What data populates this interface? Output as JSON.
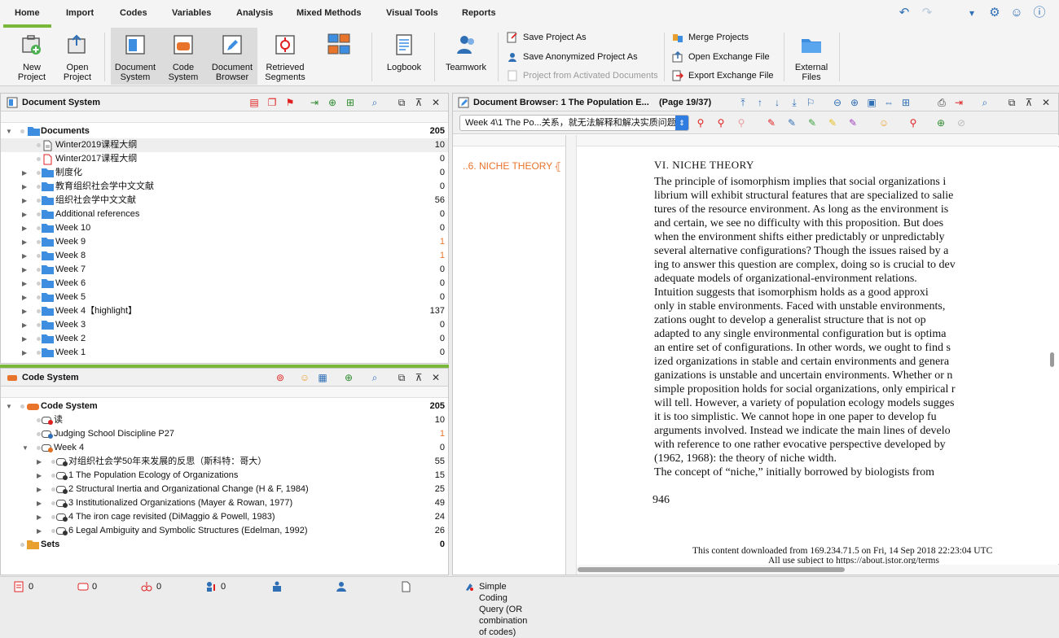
{
  "menu": {
    "tabs": [
      "Home",
      "Import",
      "Codes",
      "Variables",
      "Analysis",
      "Mixed Methods",
      "Visual Tools",
      "Reports"
    ],
    "active": "Home"
  },
  "ribbon": {
    "new_project": "New\nProject",
    "open_project": "Open\nProject",
    "document_system": "Document\nSystem",
    "code_system": "Code\nSystem",
    "document_browser": "Document\nBrowser",
    "retrieved_segments": "Retrieved\nSegments",
    "logbook": "Logbook",
    "teamwork": "Teamwork",
    "save_project_as": "Save Project As",
    "save_anonymized": "Save Anonymized Project As",
    "project_from_activated": "Project from Activated Documents",
    "merge_projects": "Merge Projects",
    "open_exchange_file": "Open Exchange File",
    "export_exchange_file": "Export Exchange File",
    "external_files": "External\nFiles"
  },
  "document_system": {
    "title": "Document System",
    "root": {
      "label": "Documents",
      "count": "205"
    },
    "items": [
      {
        "label": "Winter2019课程大纲",
        "count": "10",
        "type": "doc",
        "expand": false
      },
      {
        "label": "Winter2017课程大纲",
        "count": "0",
        "type": "pdf",
        "expand": false
      },
      {
        "label": "制度化",
        "count": "0",
        "type": "folder",
        "expand": true
      },
      {
        "label": "教育组织社会学中文文献",
        "count": "0",
        "type": "folder",
        "expand": true
      },
      {
        "label": "组织社会学中文文献",
        "count": "56",
        "type": "folder",
        "expand": true
      },
      {
        "label": "Additional references",
        "count": "0",
        "type": "folder",
        "expand": true
      },
      {
        "label": "Week 10",
        "count": "0",
        "type": "folder",
        "expand": true
      },
      {
        "label": "Week 9",
        "count": "1",
        "type": "folder",
        "expand": true
      },
      {
        "label": "Week 8",
        "count": "1",
        "type": "folder",
        "expand": true
      },
      {
        "label": "Week 7",
        "count": "0",
        "type": "folder",
        "expand": true
      },
      {
        "label": "Week 6",
        "count": "0",
        "type": "folder",
        "expand": true
      },
      {
        "label": "Week 5",
        "count": "0",
        "type": "folder",
        "expand": true
      },
      {
        "label": "Week 4【highlight】",
        "count": "137",
        "type": "folder",
        "expand": true
      },
      {
        "label": "Week 3",
        "count": "0",
        "type": "folder",
        "expand": true
      },
      {
        "label": "Week 2",
        "count": "0",
        "type": "folder",
        "expand": true
      },
      {
        "label": "Week 1",
        "count": "0",
        "type": "folder",
        "expand": true
      }
    ]
  },
  "code_system": {
    "title": "Code System",
    "root": {
      "label": "Code System",
      "count": "205"
    },
    "items": [
      {
        "label": "读",
        "count": "10",
        "indent": 1,
        "expand": false,
        "color": "#e02020"
      },
      {
        "label": "Judging School Discipline P27",
        "count": "1",
        "indent": 1,
        "expand": false,
        "color": "#2f6fb5"
      },
      {
        "label": "Week 4",
        "count": "0",
        "indent": 1,
        "expand": true,
        "open": true,
        "color": "#e07020"
      },
      {
        "label": "对组织社会学50年来发展的反思（斯科特：哥大）",
        "count": "55",
        "indent": 2,
        "expand": true,
        "color": "#333333"
      },
      {
        "label": "1 The Population Ecology of Organizations",
        "count": "15",
        "indent": 2,
        "expand": true,
        "color": "#333333"
      },
      {
        "label": "2 Structural Inertia and Organizational Change (H & F, 1984)",
        "count": "25",
        "indent": 2,
        "expand": true,
        "color": "#333333"
      },
      {
        "label": "3 Institutionalized Organizations (Mayer & Rowan, 1977)",
        "count": "49",
        "indent": 2,
        "expand": true,
        "color": "#333333"
      },
      {
        "label": "4 The iron cage revisited (DiMaggio & Powell, 1983)",
        "count": "24",
        "indent": 2,
        "expand": true,
        "color": "#333333"
      },
      {
        "label": "6 Legal Ambiguity and Symbolic Structures (Edelman, 1992)",
        "count": "26",
        "indent": 2,
        "expand": true,
        "color": "#333333"
      }
    ],
    "sets": {
      "label": "Sets",
      "count": "0"
    }
  },
  "document_browser": {
    "title": "Document Browser: 1 The Population E...",
    "page": "(Page 19/37)",
    "doc_select": "Week 4\\1 The Po...关系，就无法解释和解决实质问题",
    "coding_stripe_label": "..6. NICHE THEORY",
    "heading": "VI.  NICHE THEORY",
    "lines": [
      "The principle of isomorphism implies that social organizations i",
      "librium will exhibit structural features that are specialized to salie",
      "tures of the resource environment. As long as the environment is",
      "and certain, we see no difficulty with this proposition. But does",
      "when the environment shifts either predictably or unpredictably",
      "several alternative configurations? Though the issues raised by a",
      "ing to answer this question are complex, doing so is crucial to dev",
      "adequate models of organizational-environment relations.",
      "   Intuition suggests that isomorphism holds as a good approxi",
      "only in stable environments. Faced with unstable environments,",
      "zations ought to develop a generalist structure that is not op",
      "adapted to any single environmental configuration but is optima",
      "an entire set of configurations. In other words, we ought to find s",
      "ized organizations in stable and certain environments and genera",
      "ganizations is unstable and uncertain environments. Whether or n",
      "simple proposition holds for social organizations, only empirical r",
      "will tell. However, a variety of population ecology models sugges",
      "it is too simplistic. We cannot hope in one paper to develop fu",
      "arguments involved. Instead we indicate the main lines of develo",
      "with reference to one rather evocative perspective developed by",
      "(1962, 1968): the theory of niche width.",
      "   The concept of “niche,” initially borrowed by biologists from"
    ],
    "page_number": "946",
    "footer1": "This content downloaded from 169.234.71.5 on Fri, 14 Sep 2018 22:23:04 UTC",
    "footer2": "All use subject to https://about.jstor.org/terms"
  },
  "status": {
    "v1": "0",
    "v2": "0",
    "v3": "0",
    "v4": "0",
    "query": "Simple Coding Query (OR combination of codes)"
  },
  "colors": {
    "accent_green": "#79b83a",
    "folder_blue": "#3d8ee0",
    "code_orange": "#e8732a",
    "highlight_orange": "#e8732a"
  }
}
